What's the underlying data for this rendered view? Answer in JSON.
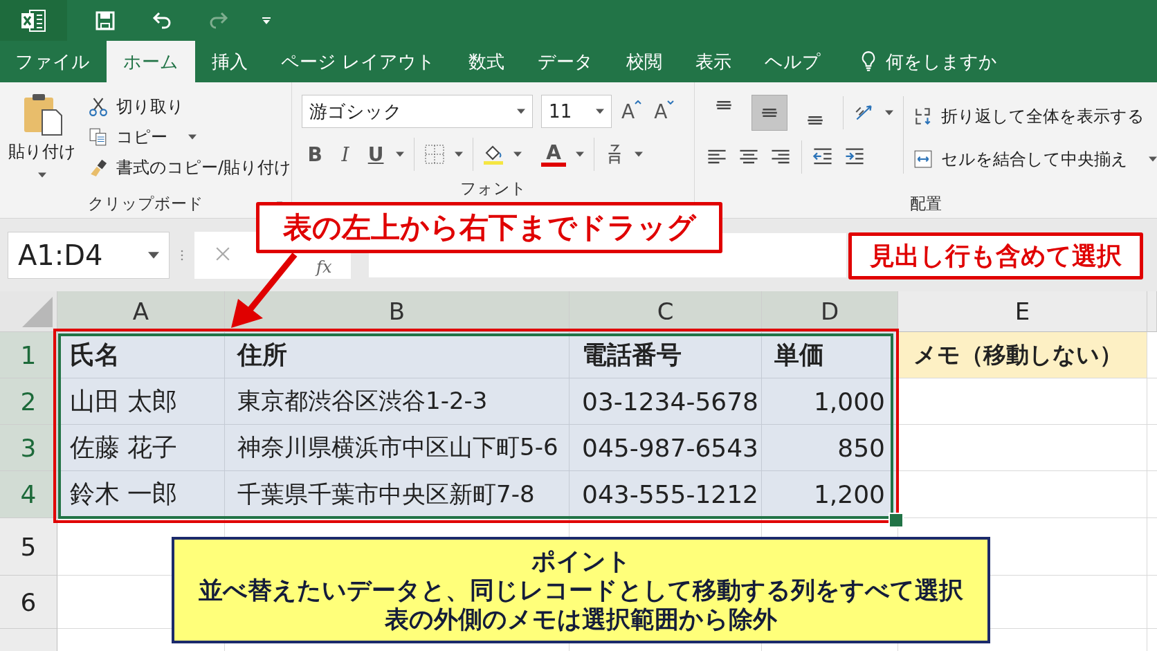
{
  "tabs": [
    {
      "label": "ファイル",
      "selected": false
    },
    {
      "label": "ホーム",
      "selected": true
    },
    {
      "label": "挿入",
      "selected": false
    },
    {
      "label": "ページ レイアウト",
      "selected": false
    },
    {
      "label": "数式",
      "selected": false
    },
    {
      "label": "データ",
      "selected": false
    },
    {
      "label": "校閲",
      "selected": false
    },
    {
      "label": "表示",
      "selected": false
    },
    {
      "label": "ヘルプ",
      "selected": false
    }
  ],
  "tell_me": "何をしますか",
  "clipboard": {
    "paste": "貼り付け",
    "cut": "切り取り",
    "copy": "コピー",
    "format_painter": "書式のコピー/貼り付け",
    "group": "クリップボード"
  },
  "font": {
    "name": "游ゴシック",
    "size": "11",
    "grow": "A",
    "shrink": "A",
    "bold": "B",
    "italic": "I",
    "underline": "U",
    "color_glyph": "A",
    "group": "フォント"
  },
  "alignment": {
    "vertical": [
      {
        "kind": "top",
        "selected": false
      },
      {
        "kind": "middle",
        "selected": true
      },
      {
        "kind": "bottom",
        "selected": false
      }
    ],
    "wrap": "折り返して全体を表示する",
    "merge": "セルを結合して中央揃え",
    "group": "配置"
  },
  "name_box": "A1:D4",
  "formula_bar": {
    "fx": "fx"
  },
  "columns": [
    {
      "label": "A",
      "selected": true
    },
    {
      "label": "B",
      "selected": true
    },
    {
      "label": "C",
      "selected": true
    },
    {
      "label": "D",
      "selected": true
    },
    {
      "label": "E",
      "selected": false
    }
  ],
  "rows": [
    {
      "header": "1",
      "selected": true,
      "bold": true,
      "cells": [
        "氏名",
        "住所",
        "電話番号",
        "単価"
      ],
      "note": "メモ（移動しない）"
    },
    {
      "header": "2",
      "selected": true,
      "bold": false,
      "cells": [
        "山田 太郎",
        "東京都渋谷区渋谷1-2-3",
        "03-1234-5678",
        "1,000"
      ]
    },
    {
      "header": "3",
      "selected": true,
      "bold": false,
      "cells": [
        "佐藤 花子",
        "神奈川県横浜市中区山下町5-6",
        "045-987-6543",
        "850"
      ]
    },
    {
      "header": "4",
      "selected": true,
      "bold": false,
      "cells": [
        "鈴木 一郎",
        "千葉県千葉市中央区新町7-8",
        "043-555-1212",
        "1,200"
      ]
    },
    {
      "header": "5",
      "selected": false
    },
    {
      "header": "6",
      "selected": false
    }
  ],
  "callouts": [
    "表の左上から右下までドラッグ",
    "見出し行も含めて選択"
  ],
  "point": {
    "title": "ポイント",
    "lines": [
      "並べ替えたいデータと、同じレコードとして移動する列をすべて選択",
      "表の外側のメモは選択範囲から除外"
    ]
  }
}
